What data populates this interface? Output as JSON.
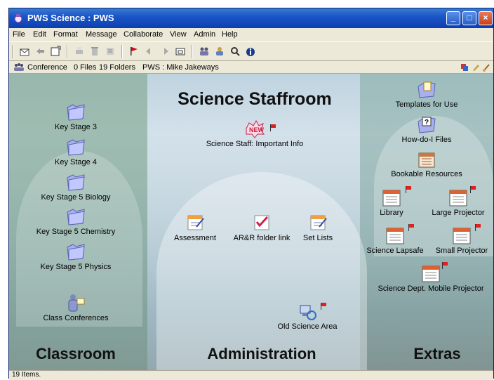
{
  "window": {
    "title": "PWS Science : PWS"
  },
  "menu": [
    "File",
    "Edit",
    "Format",
    "Message",
    "Collaborate",
    "View",
    "Admin",
    "Help"
  ],
  "infobar": {
    "location": "Conference",
    "files": "0 Files",
    "folders": "19 Folders",
    "user": "PWS : Mike Jakeways"
  },
  "sections": {
    "header": "Science Staffroom",
    "left": "Classroom",
    "middle": "Administration",
    "right": "Extras"
  },
  "classroom": {
    "ks3": "Key Stage 3",
    "ks4": "Key Stage 4",
    "ks5bio": "Key Stage 5 Biology",
    "ks5chem": "Key Stage 5 Chemistry",
    "ks5phys": "Key Stage 5 Physics",
    "conferences": "Class Conferences"
  },
  "admin": {
    "important": "Science Staff: Important Info",
    "assessment": "Assessment",
    "arr": "AR&R folder link",
    "setlists": "Set Lists",
    "old": "Old Science Area"
  },
  "extras": {
    "templates": "Templates for Use",
    "howdoi": "How-do-I Files",
    "bookable": "Bookable Resources",
    "library": "Library",
    "largeproj": "Large Projector",
    "lapsafe": "Science Lapsafe",
    "smallproj": "Small Projector",
    "mobileproj": "Science Dept. Mobile Projector"
  },
  "status": "19 Items.",
  "colors": {
    "titlebar": "#1b56c6",
    "flag": "#e02020",
    "folder": "#9aa6e8"
  }
}
